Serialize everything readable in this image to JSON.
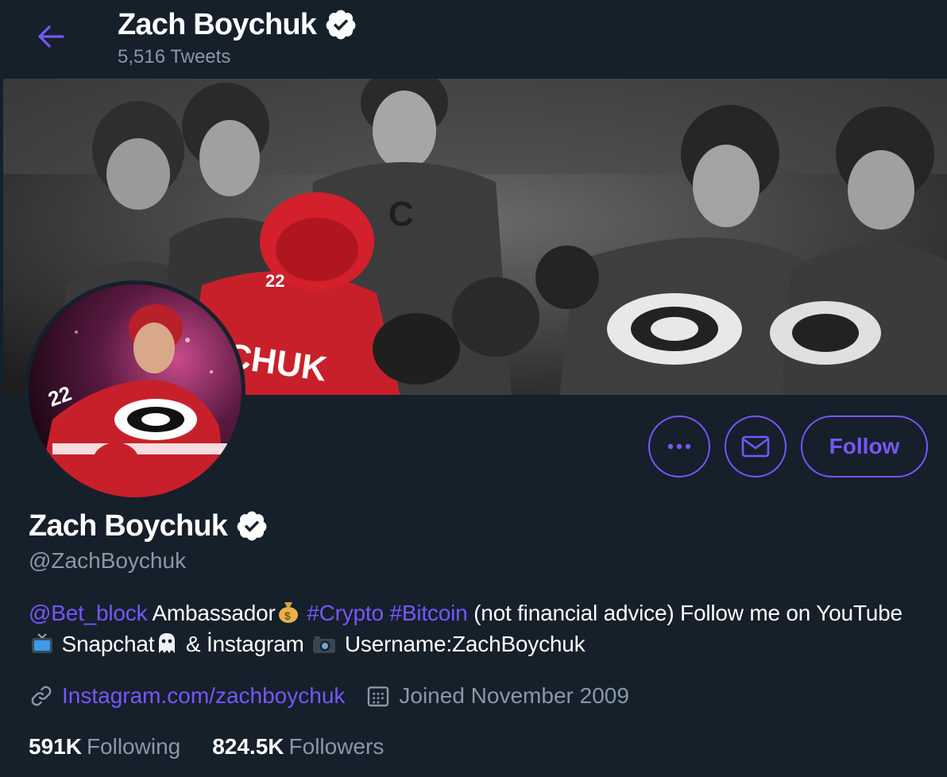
{
  "header": {
    "name": "Zach Boychuk",
    "tweet_count": "5,516 Tweets"
  },
  "actions": {
    "more_icon": "ellipsis-icon",
    "message_icon": "envelope-icon",
    "follow_label": "Follow"
  },
  "profile": {
    "name": "Zach Boychuk",
    "handle": "@ZachBoychuk",
    "verified": true,
    "bio": {
      "mention": "@Bet_block",
      "text1": "Ambassador",
      "hashtag1": "#Crypto",
      "hashtag2": "#Bitcoin",
      "text2": "(not financial advice) Follow me on YouTube",
      "text3": "Snapchat",
      "text4": "& İnstagram",
      "text5": "Username:ZachBoychuk"
    },
    "website": "Instagram.com/zachboychuk",
    "joined": "Joined November 2009"
  },
  "stats": {
    "following_count": "591K",
    "following_label": "Following",
    "followers_count": "824.5K",
    "followers_label": "Followers"
  },
  "colors": {
    "background": "#15202b",
    "accent": "#7856ff",
    "secondary_text": "#8899a6"
  }
}
